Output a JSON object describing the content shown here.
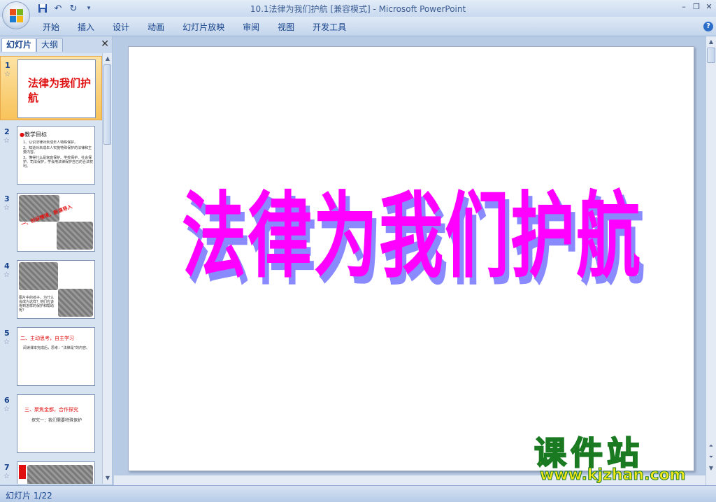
{
  "window": {
    "title": "10.1法律为我们护航 [兼容模式]",
    "app_name": "Microsoft PowerPoint",
    "title_separator": " - "
  },
  "quick_access": [
    "save-icon",
    "undo-icon",
    "redo-icon",
    "customize-icon"
  ],
  "ribbon": {
    "tabs": [
      "开始",
      "插入",
      "设计",
      "动画",
      "幻灯片放映",
      "审阅",
      "视图",
      "开发工具"
    ]
  },
  "left_pane": {
    "tab_slides": "幻灯片",
    "tab_outline": "大纲",
    "thumbnails": [
      {
        "num": "1",
        "title": "法律为我们护航"
      },
      {
        "num": "2",
        "heading": "教学目标",
        "lines": [
          "1、认识法律对未成年人特殊保护。",
          "2、知道对未成年人实施特殊保护的法律和主要内容。",
          "3、懂得什么是家庭保护、学校保护、社会保护、司法保护，学会用法律保护自己的合法权利。"
        ]
      },
      {
        "num": "3",
        "caption": "一、创设情境，新课导入"
      },
      {
        "num": "4",
        "lines": [
          "图片中的孩子，为什么会成为这样？他们应该得到怎样的保护和帮助呢？"
        ]
      },
      {
        "num": "5",
        "heading": "二、主动思考，自主学习",
        "lines": [
          "阅读课本完成后，思考：“法律是”的内容。"
        ]
      },
      {
        "num": "6",
        "heading": "三、聚焦金都，合作探究",
        "lines": [
          "探究一：我们需要特殊保护"
        ]
      },
      {
        "num": "7"
      }
    ]
  },
  "slide": {
    "title": "法律为我们护航"
  },
  "status": {
    "text": "幻灯片 1/22"
  },
  "watermark": {
    "cn": "课件站",
    "url": "www.kjzhan.com"
  },
  "colors": {
    "title_fill": "#ff00ff",
    "title_shadow": "#8a8aff",
    "watermark_fill": "#f3e61a",
    "watermark_stroke": "#1a7a22"
  }
}
